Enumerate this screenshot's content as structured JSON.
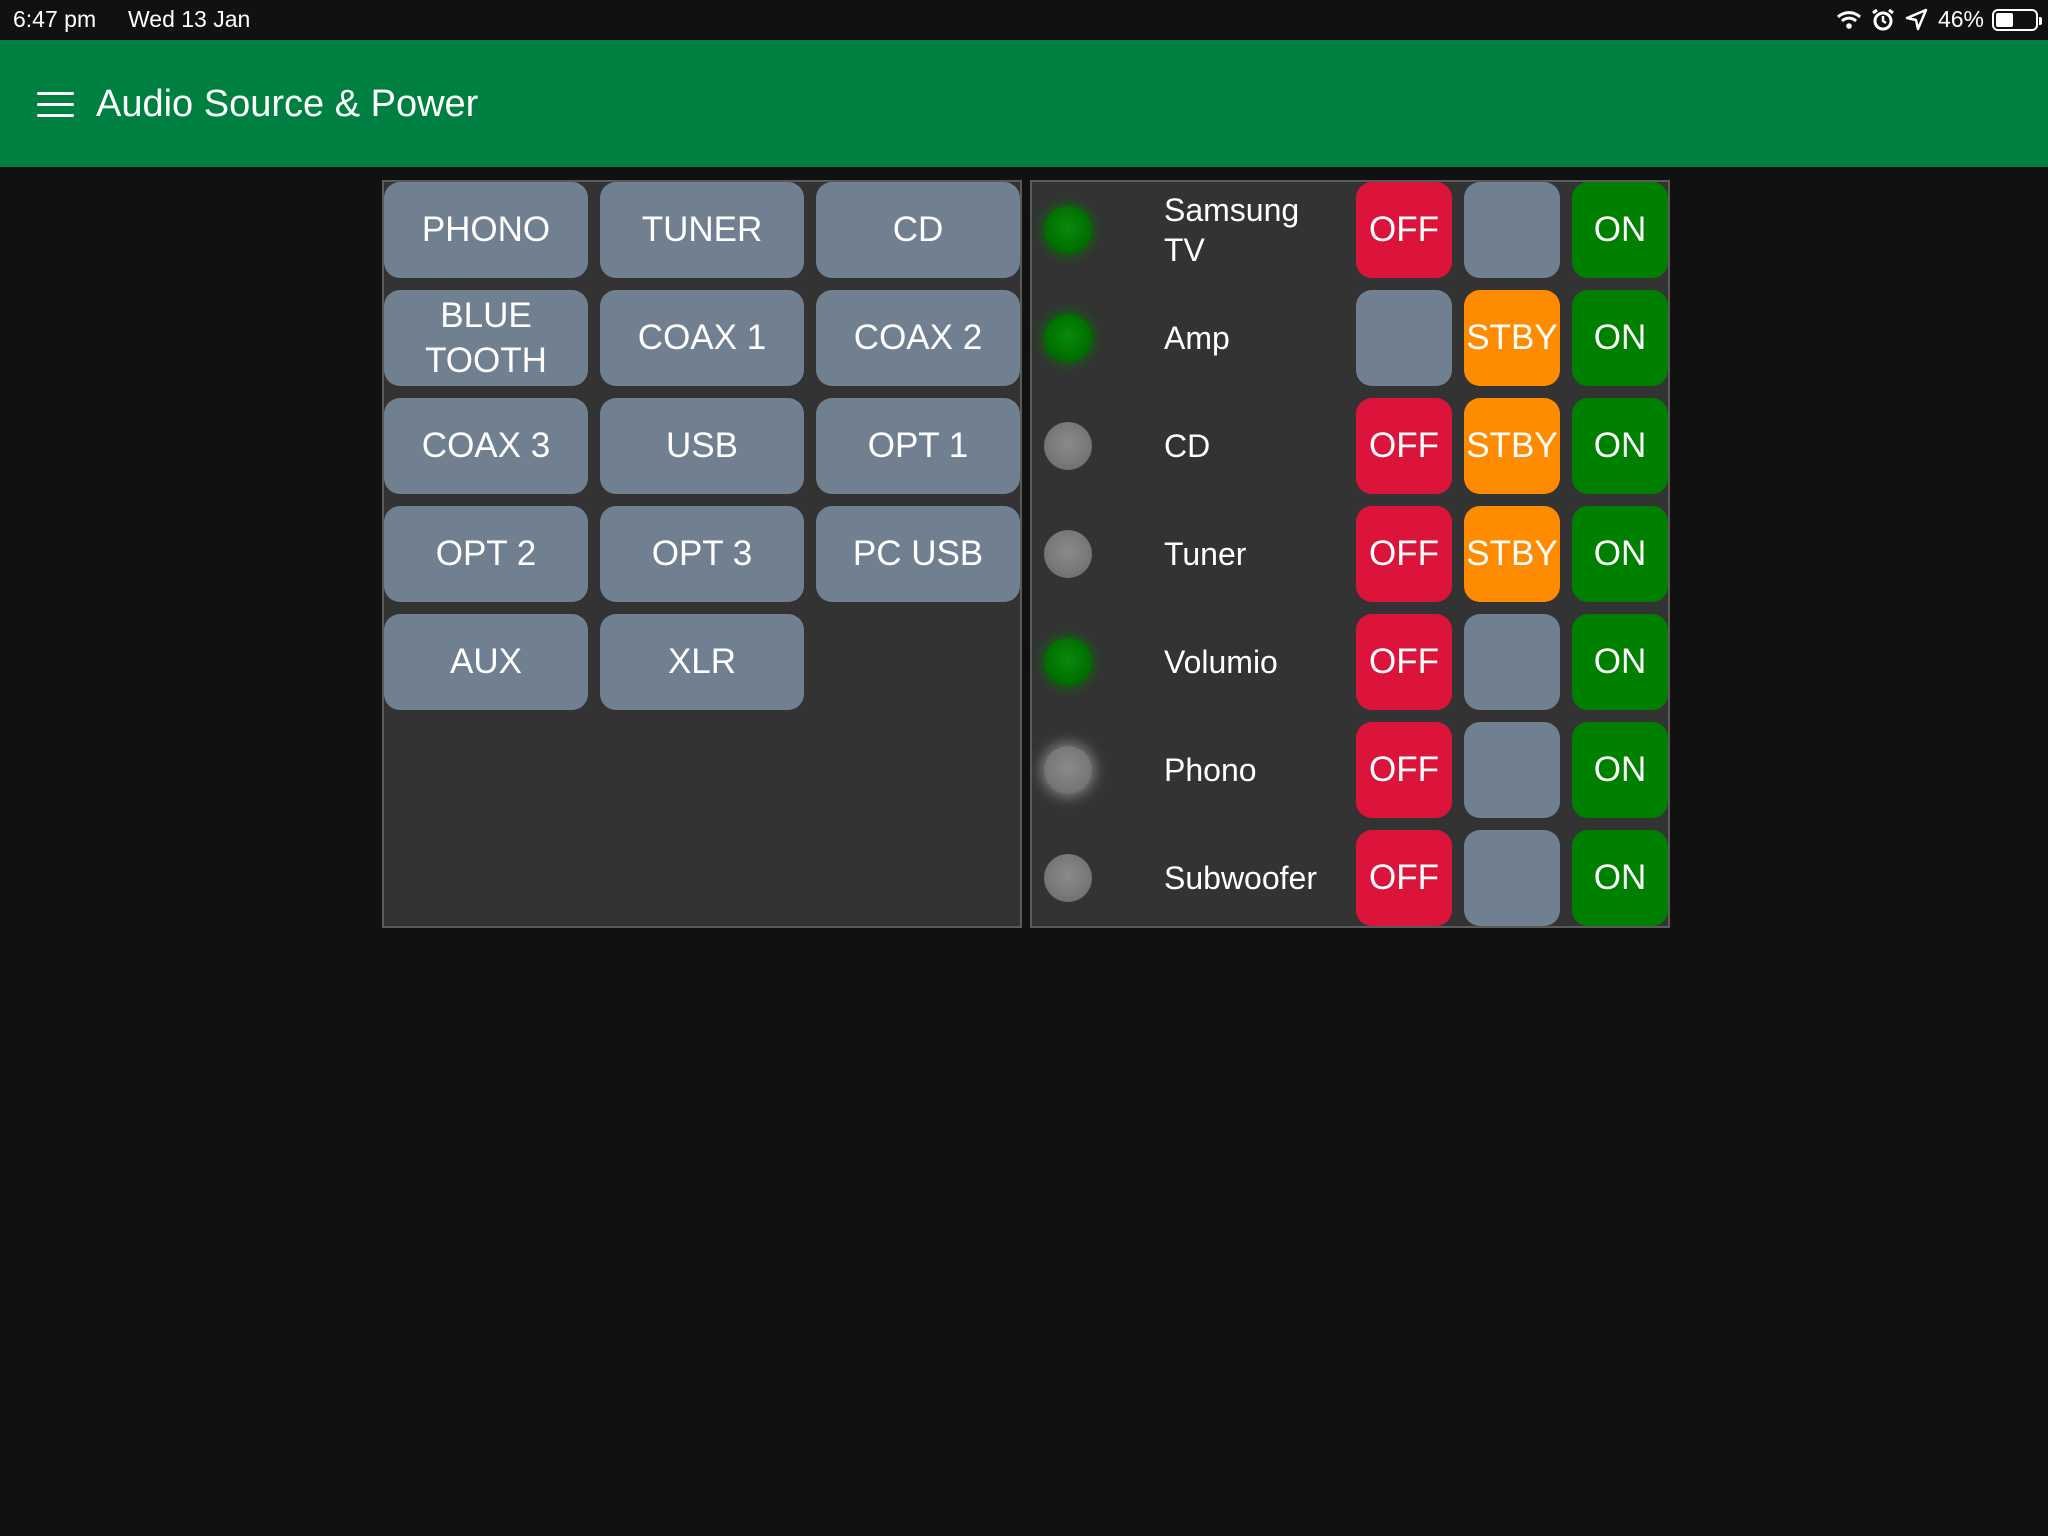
{
  "status_bar": {
    "time": "6:47 pm",
    "date": "Wed 13 Jan",
    "battery_percent_label": "46%",
    "battery_level": 0.46,
    "icons": [
      "wifi-icon",
      "alarm-icon",
      "location-icon",
      "battery-icon"
    ]
  },
  "header": {
    "title": "Audio Source & Power",
    "menu_icon": "hamburger-menu-icon",
    "background_color": "#008040"
  },
  "sources": {
    "buttons": [
      {
        "label": "PHONO"
      },
      {
        "label": "TUNER"
      },
      {
        "label": "CD"
      },
      {
        "label": "BLUE\nTOOTH"
      },
      {
        "label": "COAX 1"
      },
      {
        "label": "COAX 2"
      },
      {
        "label": "COAX 3"
      },
      {
        "label": "USB"
      },
      {
        "label": "OPT 1"
      },
      {
        "label": "OPT 2"
      },
      {
        "label": "OPT 3"
      },
      {
        "label": "PC USB"
      },
      {
        "label": "AUX"
      },
      {
        "label": "XLR"
      }
    ]
  },
  "power": {
    "colors": {
      "off": "#dc143c",
      "stby": "#ff8c00",
      "on": "#008000",
      "blank": "#708090"
    },
    "devices": [
      {
        "name": "Samsung\nTV",
        "led": "on",
        "off_label": "OFF",
        "stby_label": "",
        "on_label": "ON"
      },
      {
        "name": "Amp",
        "led": "on",
        "off_label": "",
        "stby_label": "STBY",
        "on_label": "ON"
      },
      {
        "name": "CD",
        "led": "off",
        "off_label": "OFF",
        "stby_label": "STBY",
        "on_label": "ON"
      },
      {
        "name": "Tuner",
        "led": "off",
        "off_label": "OFF",
        "stby_label": "STBY",
        "on_label": "ON"
      },
      {
        "name": "Volumio",
        "led": "on",
        "off_label": "OFF",
        "stby_label": "",
        "on_label": "ON"
      },
      {
        "name": "Phono",
        "led": "off-glow",
        "off_label": "OFF",
        "stby_label": "",
        "on_label": "ON"
      },
      {
        "name": "Subwoofer",
        "led": "off",
        "off_label": "OFF",
        "stby_label": "",
        "on_label": "ON"
      }
    ]
  }
}
